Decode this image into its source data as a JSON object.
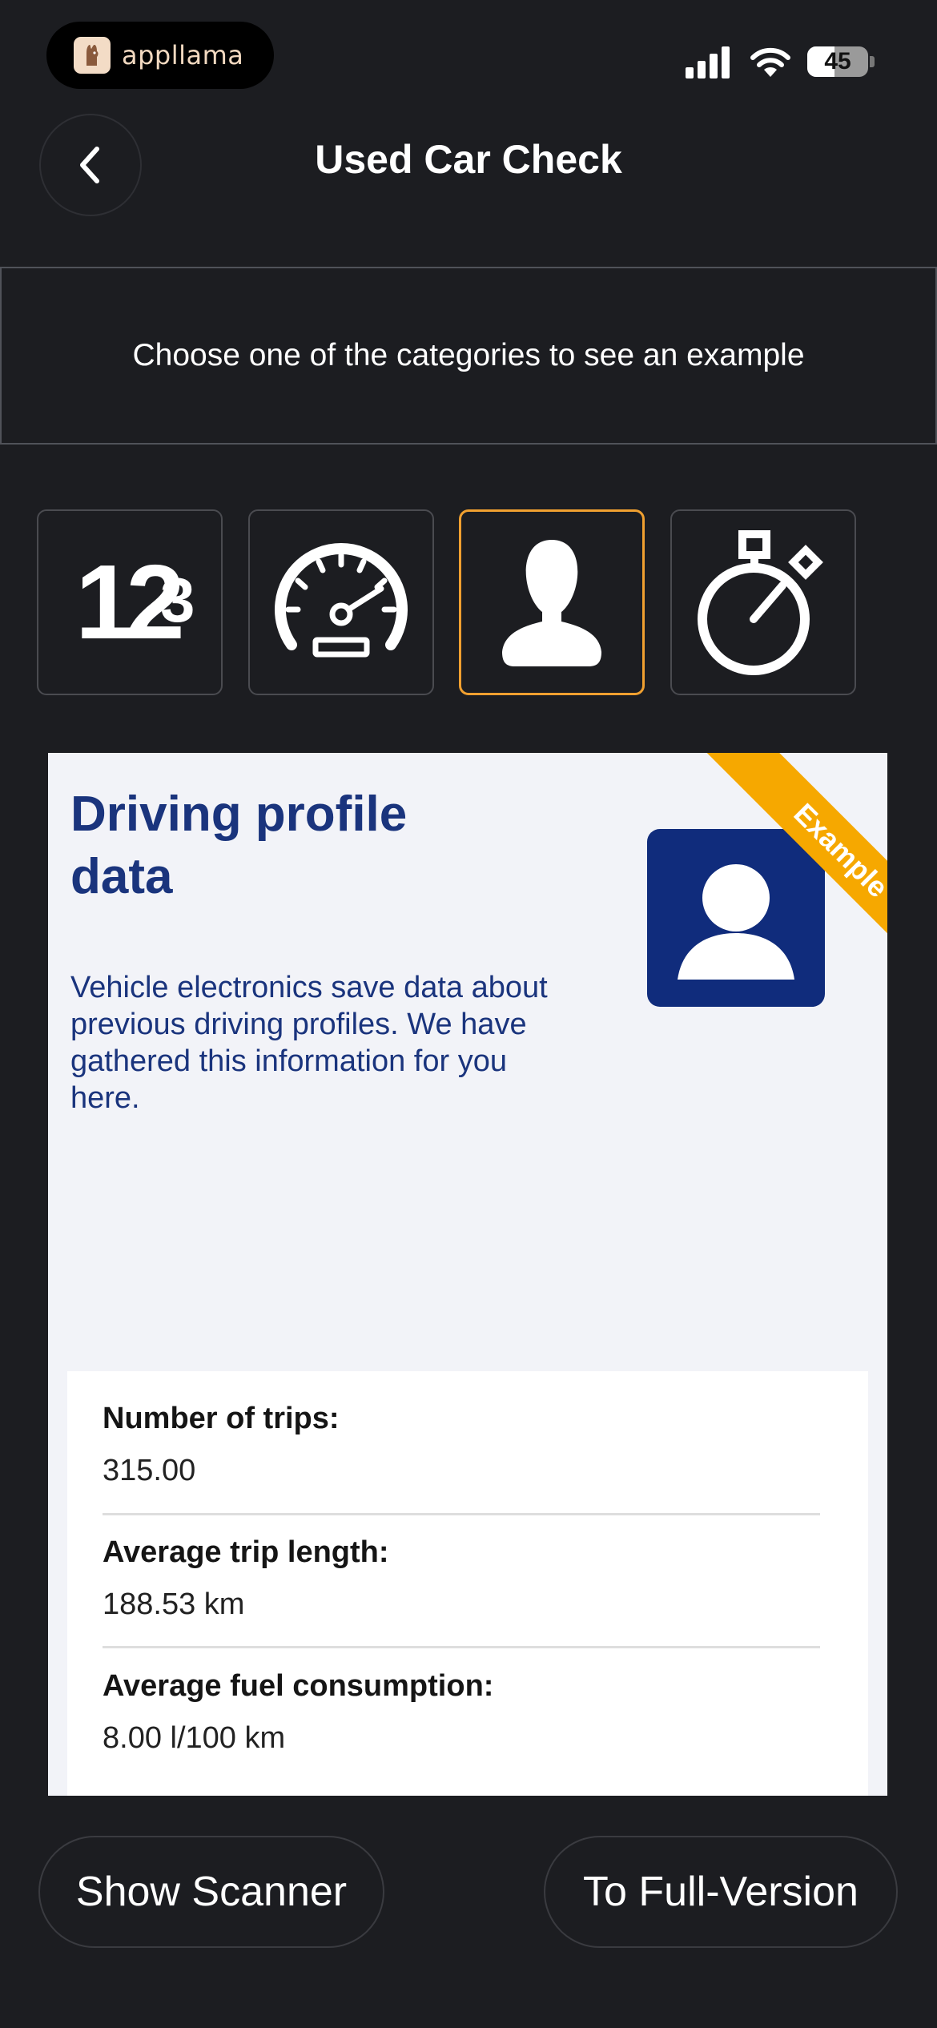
{
  "status_bar": {
    "brand_name": "appllama",
    "battery_level": "45",
    "battery_percent": 45
  },
  "header": {
    "title": "Used Car Check",
    "back_icon": "chevron-left-icon"
  },
  "banner": {
    "text": "Choose one of the categories to see an example"
  },
  "categories": [
    {
      "name": "mileage",
      "icon": "numbers-icon",
      "icon_text": "12",
      "icon_sup": "3",
      "selected": false
    },
    {
      "name": "speedometer",
      "icon": "speedometer-icon",
      "selected": false
    },
    {
      "name": "driving-profile",
      "icon": "person-icon",
      "selected": true
    },
    {
      "name": "timer",
      "icon": "stopwatch-icon",
      "selected": false
    }
  ],
  "card": {
    "title": "Driving profile data",
    "description": "Vehicle electronics save data about previous driving profiles. We have gathered this information for you here.",
    "ribbon": "Example",
    "rows": [
      {
        "label": "Number of trips:",
        "value": "315.00"
      },
      {
        "label": "Average trip length:",
        "value": "188.53 km"
      },
      {
        "label": "Average fuel consumption:",
        "value": "8.00 l/100 km"
      }
    ]
  },
  "buttons": {
    "scanner": "Show Scanner",
    "full_version": "To Full-Version"
  },
  "colors": {
    "background": "#1c1d21",
    "accent": "#f0a030",
    "card_blue": "#1a347d",
    "ribbon": "#f6a800"
  }
}
